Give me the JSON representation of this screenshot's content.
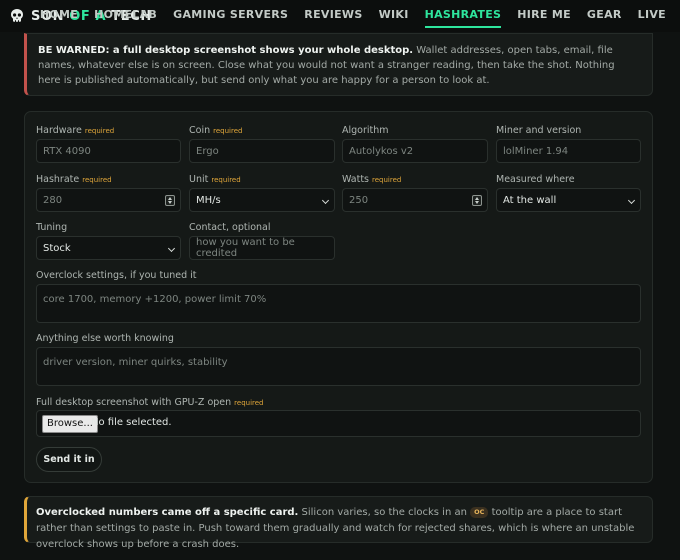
{
  "brand": {
    "name_part1": "SON ",
    "name_accent": "OF A",
    "name_part2": " TECH"
  },
  "nav": {
    "items": [
      {
        "label": "HOME"
      },
      {
        "label": "HOMELAB"
      },
      {
        "label": "GAMING SERVERS"
      },
      {
        "label": "REVIEWS"
      },
      {
        "label": "WIKI"
      },
      {
        "label": "HASHRATES",
        "active": true
      },
      {
        "label": "HIRE ME"
      },
      {
        "label": "GEAR"
      },
      {
        "label": "LIVE"
      }
    ]
  },
  "warning": {
    "bold": "BE WARNED: a full desktop screenshot shows your whole desktop.",
    "text": " Wallet addresses, open tabs, email, file names, whatever else is on screen. Close what you would not want a stranger reading, then take the shot. Nothing here is published automatically, but send only what you are happy for a person to look at."
  },
  "form": {
    "required_tag": "required",
    "hardware": {
      "label": "Hardware",
      "placeholder": "RTX 4090"
    },
    "coin": {
      "label": "Coin",
      "placeholder": "Ergo"
    },
    "algorithm": {
      "label": "Algorithm",
      "placeholder": "Autolykos v2"
    },
    "miner": {
      "label": "Miner and version",
      "placeholder": "lolMiner 1.94"
    },
    "hashrate": {
      "label": "Hashrate",
      "placeholder": "280"
    },
    "unit": {
      "label": "Unit",
      "value": "MH/s"
    },
    "watts": {
      "label": "Watts",
      "placeholder": "250"
    },
    "measured": {
      "label": "Measured where",
      "value": "At the wall"
    },
    "tuning": {
      "label": "Tuning",
      "value": "Stock"
    },
    "contact": {
      "label": "Contact, optional",
      "placeholder": "how you want to be credited"
    },
    "overclock": {
      "label": "Overclock settings, if you tuned it",
      "placeholder": "core 1700, memory +1200, power limit 70%"
    },
    "notes": {
      "label": "Anything else worth knowing",
      "placeholder": "driver version, miner quirks, stability"
    },
    "screenshot": {
      "label": "Full desktop screenshot with GPU-Z open",
      "browse": "Browse...",
      "status": "No file selected."
    },
    "submit": "Send it in"
  },
  "info": {
    "bold": "Overclocked numbers came off a specific card.",
    "text_before": " Silicon varies, so the clocks in an ",
    "badge": "OC",
    "text_after": " tooltip are a place to start rather than settings to paste in. Push toward them gradually and watch for rejected shares, which is where an unstable overclock shows up before a crash does."
  },
  "colors": {
    "accent": "#2ee59d",
    "warning_border": "#c2524c",
    "info_border": "#e0a63a",
    "required": "#e0a63a"
  },
  "icons": {
    "logo": "skull-icon",
    "spinner": "number-spinner-icon",
    "select": "chevron-down-icon"
  }
}
